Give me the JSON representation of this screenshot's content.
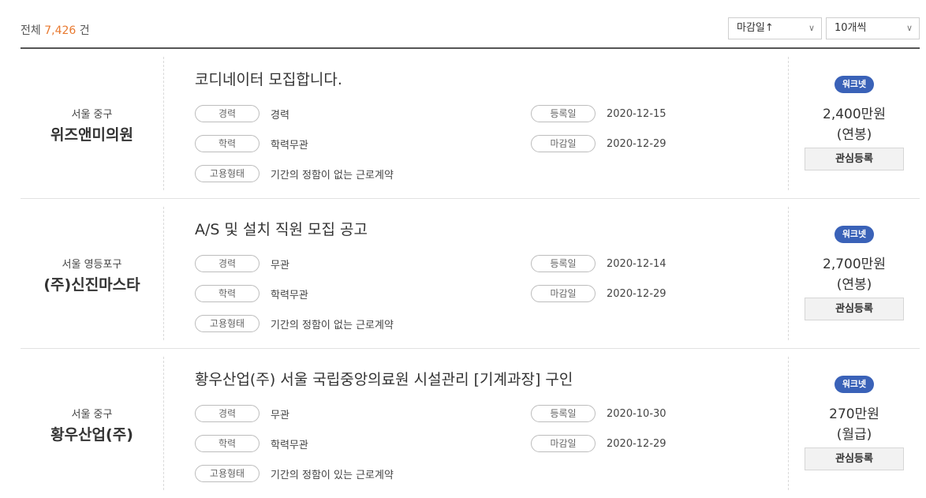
{
  "summary": {
    "prefix": "전체",
    "count": "7,426",
    "suffix": "건"
  },
  "sort_select": {
    "value": "마감일↑"
  },
  "size_select": {
    "value": "10개씩"
  },
  "jobs": [
    {
      "location": "서울 중구",
      "company": "위즈앤미의원",
      "title": "코디네이터 모집합니다.",
      "career_label": "경력",
      "career": "경력",
      "education_label": "학력",
      "education": "학력무관",
      "employment_label": "고용형태",
      "employment": "기간의 정함이 없는 근로계약",
      "registered_label": "등록일",
      "registered": "2020-12-15",
      "deadline_label": "마감일",
      "deadline": "2020-12-29",
      "badge": "워크넷",
      "salary": "2,400만원",
      "salary_type": "(연봉)",
      "fav_label": "관심등록"
    },
    {
      "location": "서울 영등포구",
      "company": "(주)신진마스타",
      "title": "A/S 및 설치 직원 모집 공고",
      "career_label": "경력",
      "career": "무관",
      "education_label": "학력",
      "education": "학력무관",
      "employment_label": "고용형태",
      "employment": "기간의 정함이 없는 근로계약",
      "registered_label": "등록일",
      "registered": "2020-12-14",
      "deadline_label": "마감일",
      "deadline": "2020-12-29",
      "badge": "워크넷",
      "salary": "2,700만원",
      "salary_type": "(연봉)",
      "fav_label": "관심등록"
    },
    {
      "location": "서울 중구",
      "company": "황우산업(주)",
      "title": "황우산업(주) 서울 국립중앙의료원 시설관리 [기계과장] 구인",
      "career_label": "경력",
      "career": "무관",
      "education_label": "학력",
      "education": "학력무관",
      "employment_label": "고용형태",
      "employment": "기간의 정함이 있는 근로계약",
      "registered_label": "등록일",
      "registered": "2020-10-30",
      "deadline_label": "마감일",
      "deadline": "2020-12-29",
      "badge": "워크넷",
      "salary": "270만원",
      "salary_type": "(월급)",
      "fav_label": "관심등록"
    }
  ],
  "colors": {
    "accent": "#e8792f",
    "badge": "#3a62b8"
  }
}
